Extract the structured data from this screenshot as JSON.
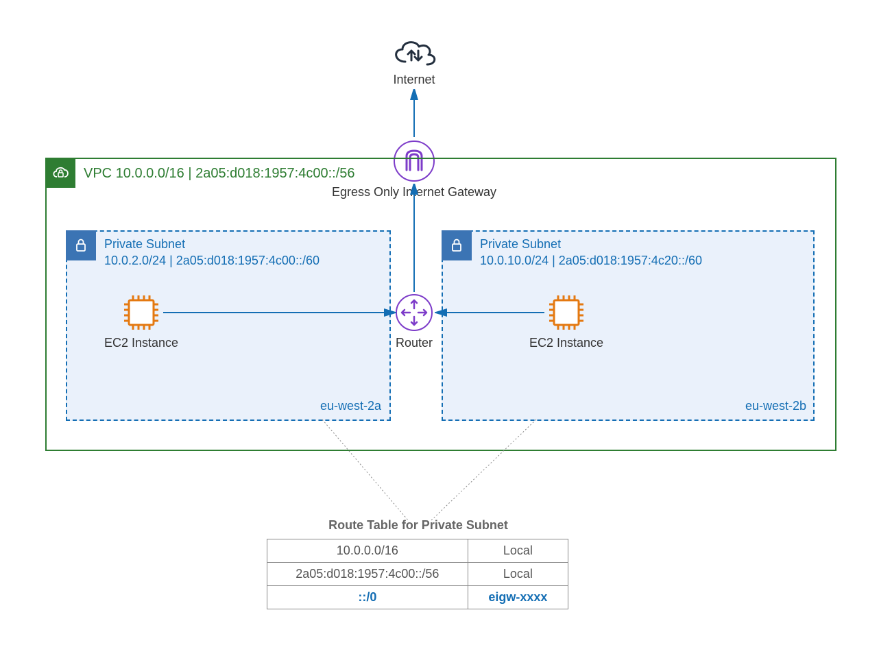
{
  "internet": {
    "label": "Internet"
  },
  "eigw": {
    "label": "Egress Only Internet Gateway"
  },
  "vpc": {
    "label_prefix": "VPC ",
    "cidr_v4": "10.0.0.0/16",
    "sep": " | ",
    "cidr_v6": "2a05:d018:1957:4c00::/56"
  },
  "subnet_a": {
    "title": "Private Subnet",
    "cidr_v4": "10.0.2.0/24",
    "sep": " | ",
    "cidr_v6": "2a05:d018:1957:4c00::/60",
    "ec2_label": "EC2 Instance",
    "az": "eu-west-2a"
  },
  "subnet_b": {
    "title": "Private Subnet",
    "cidr_v4": "10.0.10.0/24",
    "sep": " | ",
    "cidr_v6": "2a05:d018:1957:4c20::/60",
    "ec2_label": "EC2 Instance",
    "az": "eu-west-2b"
  },
  "router": {
    "label": "Router"
  },
  "route_table": {
    "title": "Route Table for Private Subnet",
    "rows": [
      {
        "dest": "10.0.0.0/16",
        "target": "Local"
      },
      {
        "dest": "2a05:d018:1957:4c00::/56",
        "target": "Local"
      },
      {
        "dest": "::/0",
        "target": "eigw-xxxx"
      }
    ]
  },
  "colors": {
    "green": "#2e7d32",
    "blue": "#146eb4",
    "purple": "#7d3cc9",
    "orange": "#e47911",
    "subnet_bg": "#eaf1fb",
    "dark": "#232f3e"
  }
}
